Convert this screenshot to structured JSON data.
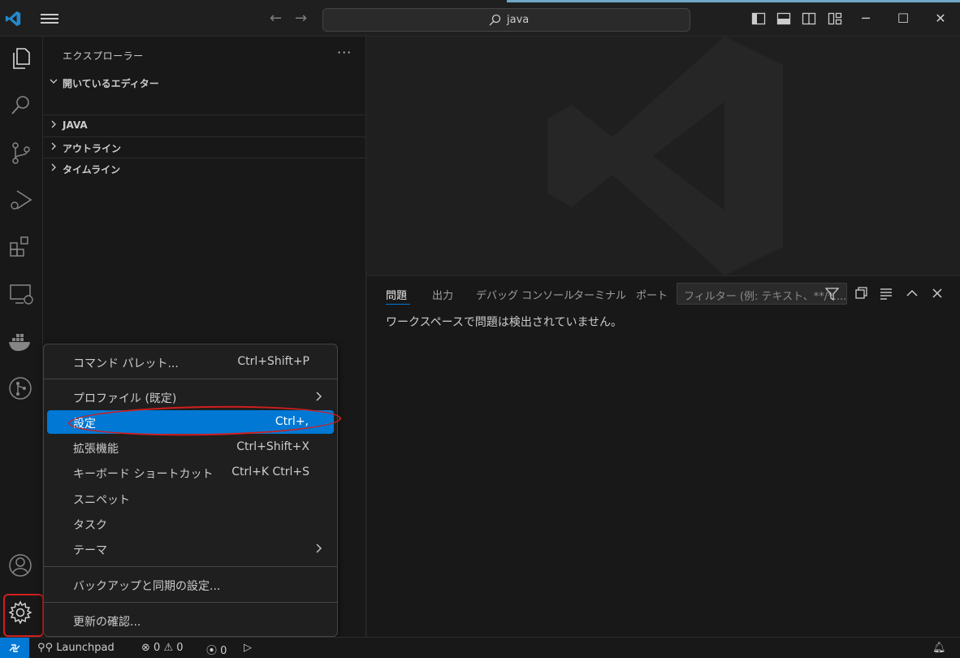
{
  "titlebar": {
    "search_text": "java",
    "back_icon": "arrow-left-icon",
    "forward_icon": "arrow-right-icon"
  },
  "sidebar": {
    "title": "エクスプローラー",
    "more": "···",
    "sections": [
      {
        "label": "開いているエディター",
        "expanded": true
      },
      {
        "label": "JAVA",
        "expanded": false
      },
      {
        "label": "アウトライン",
        "expanded": false
      },
      {
        "label": "タイムライン",
        "expanded": false
      }
    ]
  },
  "panel": {
    "tabs": [
      "問題",
      "出力",
      "デバッグ コンソール",
      "ターミナル",
      "ポート"
    ],
    "active_tab": "問題",
    "filter_placeholder": "フィルター (例: テキスト、**/*....",
    "message": "ワークスペースで問題は検出されていません。"
  },
  "menu": {
    "items": [
      {
        "label": "コマンド パレット...",
        "shortcut": "Ctrl+Shift+P"
      },
      {
        "label": "プロファイル (既定)",
        "shortcut": "",
        "submenu": true
      },
      {
        "label": "設定",
        "shortcut": "Ctrl+,",
        "selected": true
      },
      {
        "label": "拡張機能",
        "shortcut": "Ctrl+Shift+X"
      },
      {
        "label": "キーボード ショートカット",
        "shortcut": "Ctrl+K Ctrl+S"
      },
      {
        "label": "スニペット",
        "shortcut": ""
      },
      {
        "label": "タスク",
        "shortcut": ""
      },
      {
        "label": "テーマ",
        "shortcut": "",
        "submenu": true
      },
      {
        "label": "バックアップと同期の設定...",
        "shortcut": ""
      },
      {
        "label": "更新の確認...",
        "shortcut": ""
      }
    ]
  },
  "statusbar": {
    "launchpad": "Launchpad",
    "errors": "0",
    "warnings": "0",
    "ports": "0"
  },
  "colors": {
    "accent": "#0078d4",
    "highlight_annotation": "#d01f1f"
  }
}
